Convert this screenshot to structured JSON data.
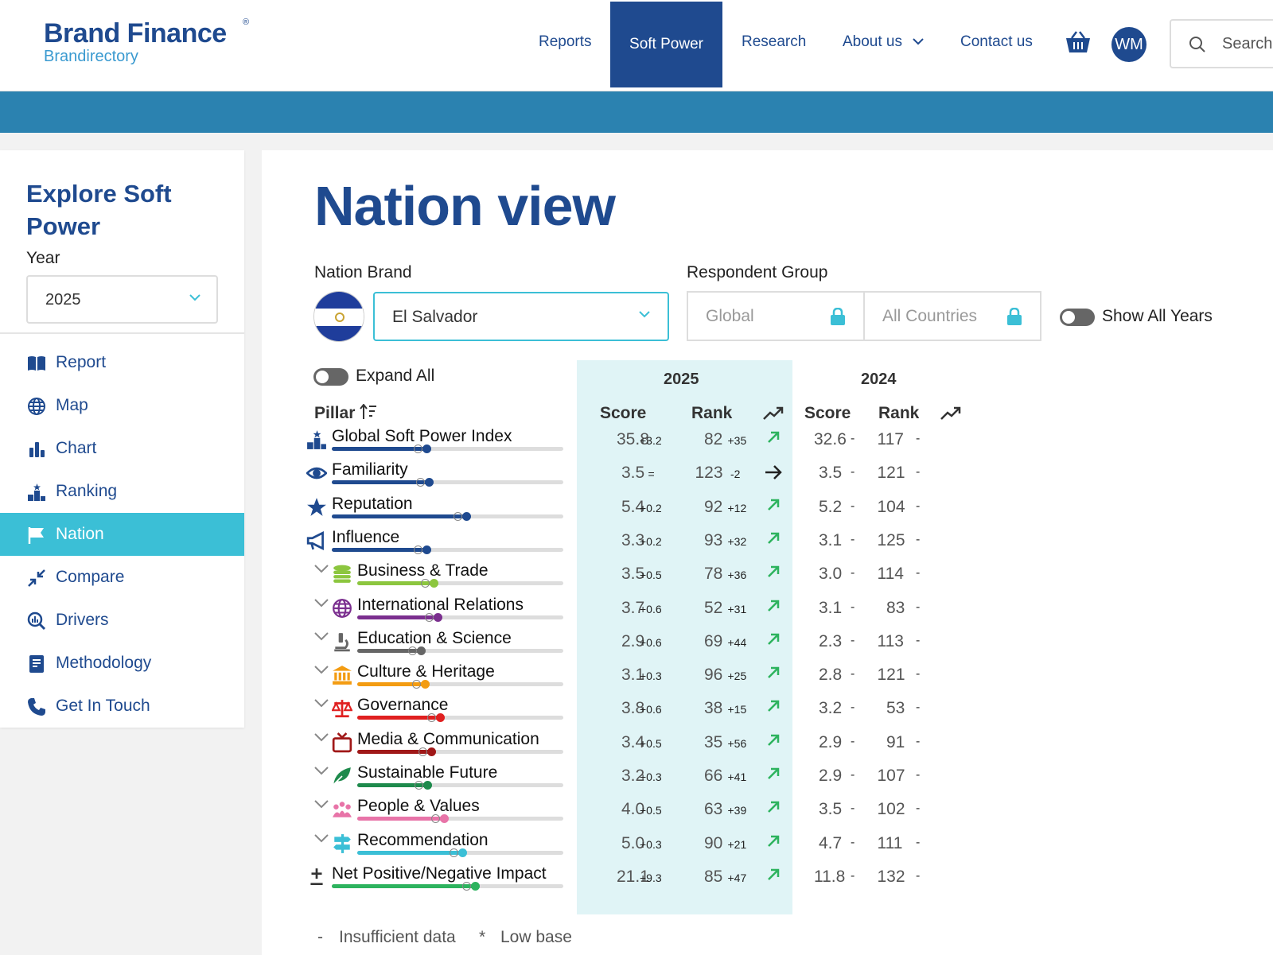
{
  "header": {
    "logo_brand": "Brand Finance",
    "logo_reg": "®",
    "logo_sub": "Brandirectory",
    "nav": [
      "Reports",
      "Soft Power",
      "Research",
      "About us",
      "Contact us"
    ],
    "active_nav": "Soft Power",
    "avatar_initials": "WM",
    "search_placeholder": "Search"
  },
  "sidebar": {
    "title": "Explore Soft Power",
    "year_label": "Year",
    "year_value": "2025",
    "items": [
      {
        "label": "Report",
        "icon": "book-icon"
      },
      {
        "label": "Map",
        "icon": "globe-icon"
      },
      {
        "label": "Chart",
        "icon": "bar-chart-icon"
      },
      {
        "label": "Ranking",
        "icon": "podium-icon"
      },
      {
        "label": "Nation",
        "icon": "flag-icon",
        "active": true
      },
      {
        "label": "Compare",
        "icon": "compare-arrows-icon"
      },
      {
        "label": "Drivers",
        "icon": "magnifier-chart-icon"
      },
      {
        "label": "Methodology",
        "icon": "notebook-icon"
      },
      {
        "label": "Get In Touch",
        "icon": "phone-icon"
      }
    ]
  },
  "main": {
    "title": "Nation view",
    "nation_brand_label": "Nation Brand",
    "nation_brand_value": "El Salvador",
    "respondent_group_label": "Respondent Group",
    "respondent_global": "Global",
    "respondent_all": "All Countries",
    "show_all_years_label": "Show All Years",
    "expand_all_label": "Expand All",
    "pillar_header": "Pillar",
    "year_2025": "2025",
    "year_2024": "2024",
    "score_header": "Score",
    "rank_header": "Rank",
    "legend_dash": "-",
    "legend_dash_text": "Insufficient data",
    "legend_star": "*",
    "legend_star_text": "Low base"
  },
  "colors": {
    "brand_blue": "#1f4a8f",
    "accent_cyan": "#3bbfd6",
    "trend_green": "#2db35e"
  },
  "rows": [
    {
      "name": "Global Soft Power Index",
      "icon": "podium-icon",
      "expandable": false,
      "color": "#1f4a8f",
      "level": 0.41,
      "s25": "35.8",
      "sd": "+3.2",
      "r25": "82",
      "rd": "+35",
      "trend": "up",
      "s24": "32.6",
      "s24d": "-",
      "r24": "117",
      "r24d": "-"
    },
    {
      "name": "Familiarity",
      "icon": "eye-icon",
      "expandable": false,
      "color": "#1f4a8f",
      "level": 0.42,
      "s25": "3.5",
      "sd": "=",
      "r25": "123",
      "rd": "-2",
      "trend": "flat",
      "s24": "3.5",
      "s24d": "-",
      "r24": "121",
      "r24d": "-"
    },
    {
      "name": "Reputation",
      "icon": "star-icon",
      "expandable": false,
      "color": "#1f4a8f",
      "level": 0.58,
      "s25": "5.4",
      "sd": "+0.2",
      "r25": "92",
      "rd": "+12",
      "trend": "up",
      "s24": "5.2",
      "s24d": "-",
      "r24": "104",
      "r24d": "-"
    },
    {
      "name": "Influence",
      "icon": "megaphone-icon",
      "expandable": false,
      "color": "#1f4a8f",
      "level": 0.41,
      "s25": "3.3",
      "sd": "+0.2",
      "r25": "93",
      "rd": "+32",
      "trend": "up",
      "s24": "3.1",
      "s24d": "-",
      "r24": "125",
      "r24d": "-"
    },
    {
      "name": "Business & Trade",
      "icon": "coins-icon",
      "expandable": true,
      "color": "#8cc63f",
      "level": 0.37,
      "s25": "3.5",
      "sd": "+0.5",
      "r25": "78",
      "rd": "+36",
      "trend": "up",
      "s24": "3.0",
      "s24d": "-",
      "r24": "114",
      "r24d": "-"
    },
    {
      "name": "International Relations",
      "icon": "globe-icon",
      "expandable": true,
      "color": "#7b2f8f",
      "level": 0.39,
      "s25": "3.7",
      "sd": "+0.6",
      "r25": "52",
      "rd": "+31",
      "trend": "up",
      "s24": "3.1",
      "s24d": "-",
      "r24": "83",
      "r24d": "-"
    },
    {
      "name": "Education & Science",
      "icon": "microscope-icon",
      "expandable": true,
      "color": "#666666",
      "level": 0.31,
      "s25": "2.9",
      "sd": "+0.6",
      "r25": "69",
      "rd": "+44",
      "trend": "up",
      "s24": "2.3",
      "s24d": "-",
      "r24": "113",
      "r24d": "-"
    },
    {
      "name": "Culture & Heritage",
      "icon": "museum-icon",
      "expandable": true,
      "color": "#f39c12",
      "level": 0.33,
      "s25": "3.1",
      "sd": "+0.3",
      "r25": "96",
      "rd": "+25",
      "trend": "up",
      "s24": "2.8",
      "s24d": "-",
      "r24": "121",
      "r24d": "-"
    },
    {
      "name": "Governance",
      "icon": "scales-icon",
      "expandable": true,
      "color": "#e02020",
      "level": 0.4,
      "s25": "3.8",
      "sd": "+0.6",
      "r25": "38",
      "rd": "+15",
      "trend": "up",
      "s24": "3.2",
      "s24d": "-",
      "r24": "53",
      "r24d": "-"
    },
    {
      "name": "Media & Communication",
      "icon": "tv-icon",
      "expandable": true,
      "color": "#a01818",
      "level": 0.36,
      "s25": "3.4",
      "sd": "+0.5",
      "r25": "35",
      "rd": "+56",
      "trend": "up",
      "s24": "2.9",
      "s24d": "-",
      "r24": "91",
      "r24d": "-"
    },
    {
      "name": "Sustainable Future",
      "icon": "leaf-icon",
      "expandable": true,
      "color": "#1e8a4c",
      "level": 0.34,
      "s25": "3.2",
      "sd": "+0.3",
      "r25": "66",
      "rd": "+41",
      "trend": "up",
      "s24": "2.9",
      "s24d": "-",
      "r24": "107",
      "r24d": "-"
    },
    {
      "name": "People & Values",
      "icon": "people-icon",
      "expandable": true,
      "color": "#e874a8",
      "level": 0.42,
      "s25": "4.0",
      "sd": "+0.5",
      "r25": "63",
      "rd": "+39",
      "trend": "up",
      "s24": "3.5",
      "s24d": "-",
      "r24": "102",
      "r24d": "-"
    },
    {
      "name": "Recommendation",
      "icon": "signpost-icon",
      "expandable": true,
      "color": "#3bbfd6",
      "level": 0.51,
      "s25": "5.0",
      "sd": "+0.3",
      "r25": "90",
      "rd": "+21",
      "trend": "up",
      "s24": "4.7",
      "s24d": "-",
      "r24": "111",
      "r24d": "-"
    },
    {
      "name": "Net Positive/Negative Impact",
      "icon": "plus-minus-icon",
      "expandable": false,
      "color": "#2db35e",
      "level": 0.62,
      "s25": "21.1",
      "sd": "+9.3",
      "r25": "85",
      "rd": "+47",
      "trend": "up",
      "s24": "11.8",
      "s24d": "-",
      "r24": "132",
      "r24d": "-"
    }
  ]
}
